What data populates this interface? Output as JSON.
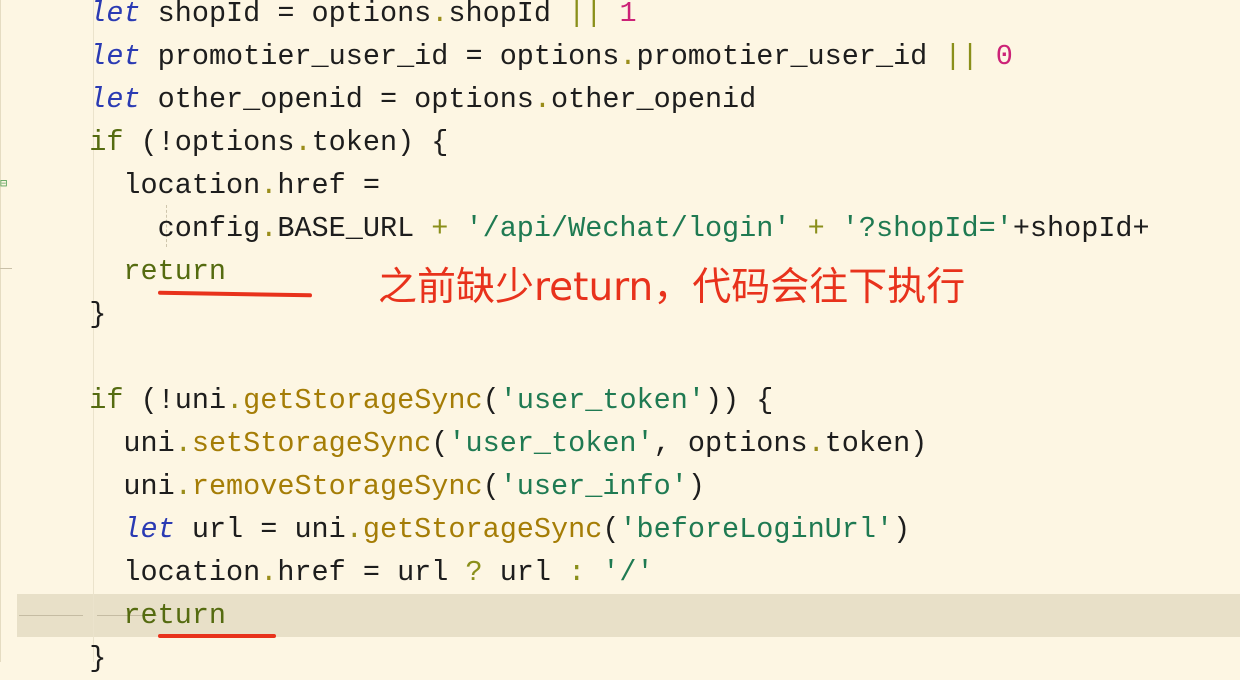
{
  "editor": {
    "lines": [
      [
        {
          "t": "  "
        },
        {
          "t": "let",
          "c": "kw-let"
        },
        {
          "t": " shopId = options"
        },
        {
          "t": ".",
          "c": "dot"
        },
        {
          "t": "shopId "
        },
        {
          "t": "||",
          "c": "op"
        },
        {
          "t": " "
        },
        {
          "t": "1",
          "c": "num"
        }
      ],
      [
        {
          "t": "  "
        },
        {
          "t": "let",
          "c": "kw-let"
        },
        {
          "t": " promotier_user_id = options"
        },
        {
          "t": ".",
          "c": "dot"
        },
        {
          "t": "promotier_user_id "
        },
        {
          "t": "||",
          "c": "op"
        },
        {
          "t": " "
        },
        {
          "t": "0",
          "c": "num"
        }
      ],
      [
        {
          "t": "  "
        },
        {
          "t": "let",
          "c": "kw-let"
        },
        {
          "t": " other_openid = options"
        },
        {
          "t": ".",
          "c": "dot"
        },
        {
          "t": "other_openid"
        }
      ],
      [
        {
          "t": "  "
        },
        {
          "t": "if",
          "c": "kw"
        },
        {
          "t": " (!options"
        },
        {
          "t": ".",
          "c": "dot"
        },
        {
          "t": "token) {"
        }
      ],
      [
        {
          "t": "    location"
        },
        {
          "t": ".",
          "c": "dot"
        },
        {
          "t": "href ="
        }
      ],
      [
        {
          "t": "      config"
        },
        {
          "t": ".",
          "c": "dot"
        },
        {
          "t": "BASE_URL "
        },
        {
          "t": "+",
          "c": "op"
        },
        {
          "t": " "
        },
        {
          "t": "'/api/Wechat/login'",
          "c": "str"
        },
        {
          "t": " "
        },
        {
          "t": "+",
          "c": "op"
        },
        {
          "t": " "
        },
        {
          "t": "'?shopId='",
          "c": "str"
        },
        {
          "t": "+shopId+"
        }
      ],
      [
        {
          "t": "    "
        },
        {
          "t": "return",
          "c": "kw"
        }
      ],
      [
        {
          "t": "  }"
        }
      ],
      [
        {
          "t": ""
        }
      ],
      [
        {
          "t": "  "
        },
        {
          "t": "if",
          "c": "kw"
        },
        {
          "t": " (!uni"
        },
        {
          "t": ".",
          "c": "dot"
        },
        {
          "t": "getStorageSync",
          "c": "fn"
        },
        {
          "t": "("
        },
        {
          "t": "'user_token'",
          "c": "str"
        },
        {
          "t": ")) {"
        }
      ],
      [
        {
          "t": "    uni"
        },
        {
          "t": ".",
          "c": "dot"
        },
        {
          "t": "setStorageSync",
          "c": "fn"
        },
        {
          "t": "("
        },
        {
          "t": "'user_token'",
          "c": "str"
        },
        {
          "t": ", options"
        },
        {
          "t": ".",
          "c": "dot"
        },
        {
          "t": "token)"
        }
      ],
      [
        {
          "t": "    uni"
        },
        {
          "t": ".",
          "c": "dot"
        },
        {
          "t": "removeStorageSync",
          "c": "fn"
        },
        {
          "t": "("
        },
        {
          "t": "'user_info'",
          "c": "str"
        },
        {
          "t": ")"
        }
      ],
      [
        {
          "t": "    "
        },
        {
          "t": "let",
          "c": "kw-let"
        },
        {
          "t": " url = uni"
        },
        {
          "t": ".",
          "c": "dot"
        },
        {
          "t": "getStorageSync",
          "c": "fn"
        },
        {
          "t": "("
        },
        {
          "t": "'beforeLoginUrl'",
          "c": "str"
        },
        {
          "t": ")"
        }
      ],
      [
        {
          "t": "    location"
        },
        {
          "t": ".",
          "c": "dot"
        },
        {
          "t": "href = url "
        },
        {
          "t": "?",
          "c": "op"
        },
        {
          "t": " url "
        },
        {
          "t": ":",
          "c": "op"
        },
        {
          "t": " "
        },
        {
          "t": "'/'",
          "c": "str"
        }
      ],
      [
        {
          "t": "    "
        },
        {
          "t": "return",
          "c": "kw"
        }
      ],
      [
        {
          "t": "  }"
        }
      ]
    ]
  },
  "annotation": {
    "text": "之前缺少return，代码会往下执行"
  },
  "colors": {
    "background": "#fdf6e3",
    "annotation": "#e8321c",
    "current_line": "#e8e0c8"
  }
}
